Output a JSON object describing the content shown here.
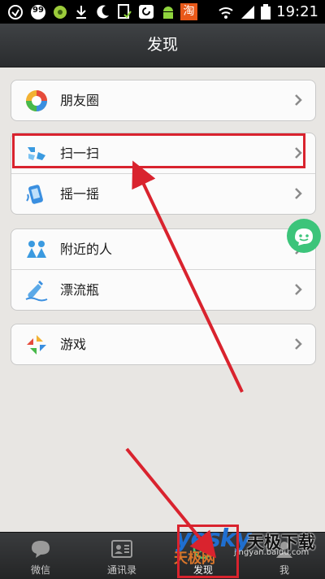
{
  "statusbar": {
    "badge": "99",
    "shop_icon": "淘",
    "time": "19:21",
    "icons": [
      "android-debug-icon",
      "badge-99-icon",
      "pea-icon",
      "download-icon",
      "moon-icon",
      "clipboard-check-icon",
      "sync-icon",
      "android-icon",
      "taobao-icon",
      "wifi-icon",
      "signal-icon",
      "battery-icon"
    ]
  },
  "header": {
    "title": "发现"
  },
  "menu": {
    "groups": [
      {
        "items": [
          {
            "label": "朋友圈",
            "icon": "moments-icon"
          }
        ]
      },
      {
        "items": [
          {
            "label": "扫一扫",
            "icon": "scan-icon"
          },
          {
            "label": "摇一摇",
            "icon": "shake-icon"
          }
        ]
      },
      {
        "items": [
          {
            "label": "附近的人",
            "icon": "people-nearby-icon"
          },
          {
            "label": "漂流瓶",
            "icon": "drift-bottle-icon"
          }
        ]
      },
      {
        "items": [
          {
            "label": "游戏",
            "icon": "games-icon"
          }
        ]
      }
    ]
  },
  "tabs": [
    {
      "label": "微信",
      "icon": "chat-bubble-icon"
    },
    {
      "label": "通讯录",
      "icon": "contacts-icon"
    },
    {
      "label": "发现",
      "icon": "compass-icon",
      "active": true
    },
    {
      "label": "我",
      "icon": "me-icon"
    }
  ],
  "watermark": {
    "brand": "yesky",
    "brand_cn": "天极网",
    "site_cn": "天极下载",
    "url": "jingyan.baidu.com"
  },
  "colors": {
    "accent_red": "#d9232e",
    "title_bar": "#35383a",
    "background": "#e8e6e3",
    "floating_button": "#3cc47a"
  }
}
